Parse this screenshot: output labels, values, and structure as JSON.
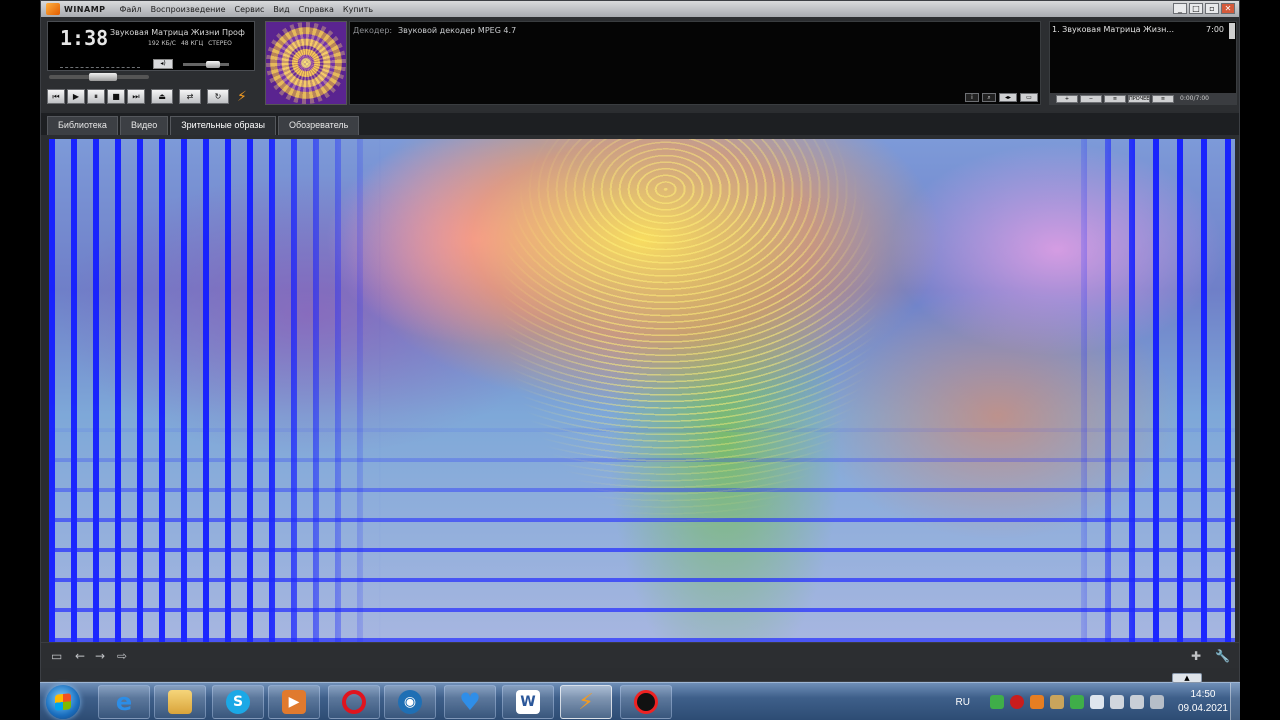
{
  "window": {
    "app_name": "WINAMP",
    "menu": [
      "Файл",
      "Воспроизведение",
      "Сервис",
      "Вид",
      "Справка",
      "Купить"
    ],
    "controls": [
      "_",
      "□",
      "▫",
      "✕"
    ]
  },
  "player": {
    "time": "1:38",
    "track_title": "Звуковая Матрица Жизни Проф",
    "bitrate": "192",
    "bitrate_unit": "КБ/С",
    "samplerate": "48",
    "samplerate_unit": "КГЦ",
    "channels": "СТЕРЕО",
    "position_progress": 0.55,
    "volume_level": 0.72
  },
  "info": {
    "decoder_label": "Декодер:",
    "decoder_value": "Звуковой декодер MPEG 4.7"
  },
  "playlist": {
    "items": [
      {
        "title": "1. Звуковая Матрица Жизн...",
        "duration": "7:00"
      }
    ],
    "time": "0:00/7:00",
    "misc_label": "ПРОЧЕЕ"
  },
  "tabs": [
    "Библиотека",
    "Видео",
    "Зрительные образы",
    "Обозреватель"
  ],
  "active_tab": "Зрительные образы",
  "taskbar": {
    "apps": [
      "start",
      "internet-explorer",
      "explorer",
      "skype",
      "media-player",
      "opera",
      "browser",
      "heart-app",
      "word",
      "winamp",
      "recorder"
    ],
    "language": "RU",
    "time": "14:50",
    "date": "09.04.2021"
  },
  "colors": {
    "accent": "#f29b22",
    "viz_blue": "#141eff",
    "taskbar": "#3e5f8a"
  }
}
